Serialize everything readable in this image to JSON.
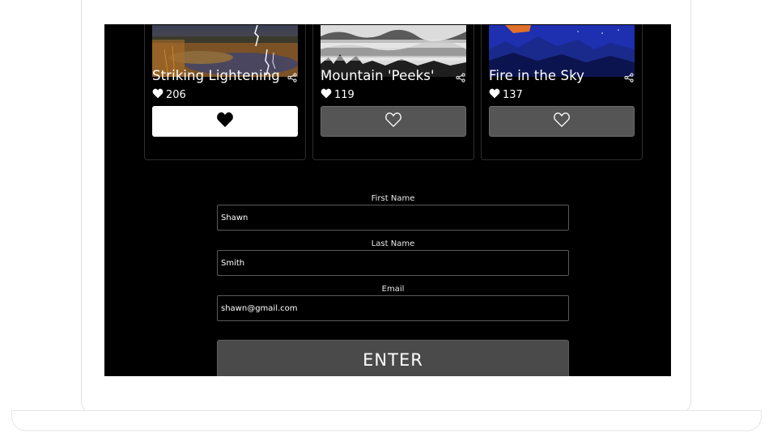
{
  "cards": [
    {
      "title": "Striking Lightening",
      "likes": "206",
      "liked": true
    },
    {
      "title": "Mountain 'Peeks'",
      "likes": "119",
      "liked": false
    },
    {
      "title": "Fire in the Sky",
      "likes": "137",
      "liked": false
    }
  ],
  "form": {
    "first_name": {
      "label": "First Name",
      "value": "Shawn"
    },
    "last_name": {
      "label": "Last Name",
      "value": "Smith"
    },
    "email": {
      "label": "Email",
      "value": "shawn@gmail.com"
    },
    "submit_label": "ENTER"
  },
  "colors": {
    "screen_bg": "#000000",
    "liked_button": "#ffffff",
    "unliked_button": "#555555",
    "enter_button": "#4a4a4a"
  },
  "icons": {
    "share": "share-icon",
    "heart": "heart-icon",
    "heart_outline": "heart-outline-icon"
  }
}
